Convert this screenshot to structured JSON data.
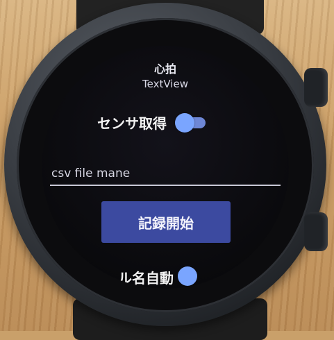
{
  "screen": {
    "title": "心拍",
    "subtitle": "TextView",
    "sensor_toggle": {
      "label": "センサ取得",
      "state": "on"
    },
    "csv_input": {
      "placeholder": "csv file mane"
    },
    "record_button": {
      "label": "記録開始"
    },
    "auto_toggle": {
      "label": "ル名自動",
      "state": "on"
    }
  },
  "colors": {
    "accent": "#7aa5ff",
    "button": "#3c4aa0",
    "screen_bg": "#0a0a0d"
  }
}
